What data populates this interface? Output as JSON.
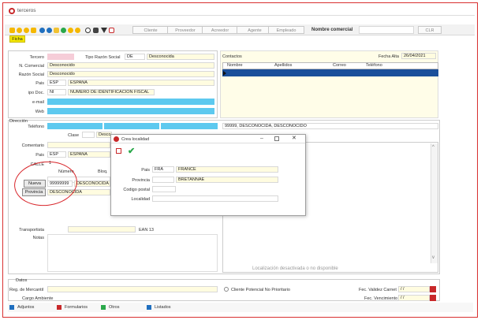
{
  "window": {
    "title": "terceros"
  },
  "toolbar": {
    "tab_label": "Ficha",
    "buttons": [
      "Cliente",
      "Proveedor",
      "Acreedor",
      "Agente",
      "Empleado"
    ],
    "search_label": "Nombre comercial",
    "search_value": "",
    "clear_label": "CLR",
    "icons": [
      "first-icon",
      "prev-icon",
      "next-icon",
      "last-icon",
      "add-icon",
      "delete-icon",
      "edit-icon",
      "confirm-icon",
      "cancel-icon",
      "refresh-icon",
      "search-icon",
      "print-icon",
      "filter-icon",
      "exit-icon"
    ]
  },
  "tercero": {
    "tercero_label": "Tercero",
    "tercero_value": "",
    "tipo_razon_label": "Tipo Razón Social",
    "tipo_razon_code": "DE",
    "tipo_razon_value": "Desconocida",
    "nif_label": "N. Comercial",
    "nif_value": "Desconocido",
    "razon_label": "Razón Social",
    "razon_value": "Desconocido",
    "pais_label": "Pais",
    "pais_code": "ESP",
    "pais_value": "ESPAÑA",
    "tipo_doc_label": "ipo Doc.",
    "tipo_doc_code": "NI",
    "tipo_doc_value": "NUMERO DE IDENTIFICACION FISCAL",
    "email_label": "e-mail",
    "web_label": "Web"
  },
  "contactos": {
    "title": "Contactos",
    "fecha_alta_label": "Fecha Alta",
    "fecha_alta_value": "26/04/2021",
    "columns": [
      "Nombre",
      "Apellidos",
      "Correo",
      "Teléfono"
    ]
  },
  "direccion": {
    "section_label": "Dirección",
    "telefono_label": "Teléfono",
    "clase_label": "Clase",
    "clase_value": "Desconocida",
    "comentario_label": "Comentario",
    "pais_label": "Pais",
    "pais_code": "ESP",
    "pais_value": "ESPAÑA",
    "calle_label": "CALLE",
    "calle_value": "1",
    "numero_label": "Número",
    "bloque_label": "Bloq.",
    "nueva_button": "Nueva",
    "localidad_code": "99999999",
    "localidad_value": "DESCONOCIDA",
    "provincia_button": "Provincia",
    "provincia_value": "DESCONOCIDA",
    "right_value": "99999, DESCONOCIDA, DESCONOCIDO",
    "transportista_label": "Transportista",
    "transportista_value": "EAN 13",
    "notas_label": "Notas",
    "map_status": "Localización desactivada o no disponible"
  },
  "datos": {
    "section_label": "Datos",
    "registro_label": "Reg. de Mercantil",
    "cargo_label": "Cargo Ambiente",
    "checkbox_label": "Cliente Potencial No Prioritario",
    "validez_label": "Fec. Validez Carnet",
    "validez_value": "/ /",
    "vencimiento_label": "Fec. Vencimiento",
    "vencimiento_value": "/ /"
  },
  "bottom_tabs": [
    "Adjuntos",
    "Formularios",
    "Otros",
    "Listados"
  ],
  "dialog": {
    "title": "Crea localidad",
    "pais_label": "Pais",
    "pais_code": "FRA",
    "pais_value": "FRANCE",
    "provincia_label": "Provincia",
    "provincia_value": "BRETANNAE",
    "codigo_label": "Codigo postal",
    "codigo_value": "",
    "localidad_label": "Localidad",
    "localidad_value": ""
  },
  "colors": {
    "accent_cyan": "#5dc9ef",
    "field_yellow": "#fffce0",
    "annotation_red": "#d8262b",
    "navy_row": "#1a4f9a"
  }
}
